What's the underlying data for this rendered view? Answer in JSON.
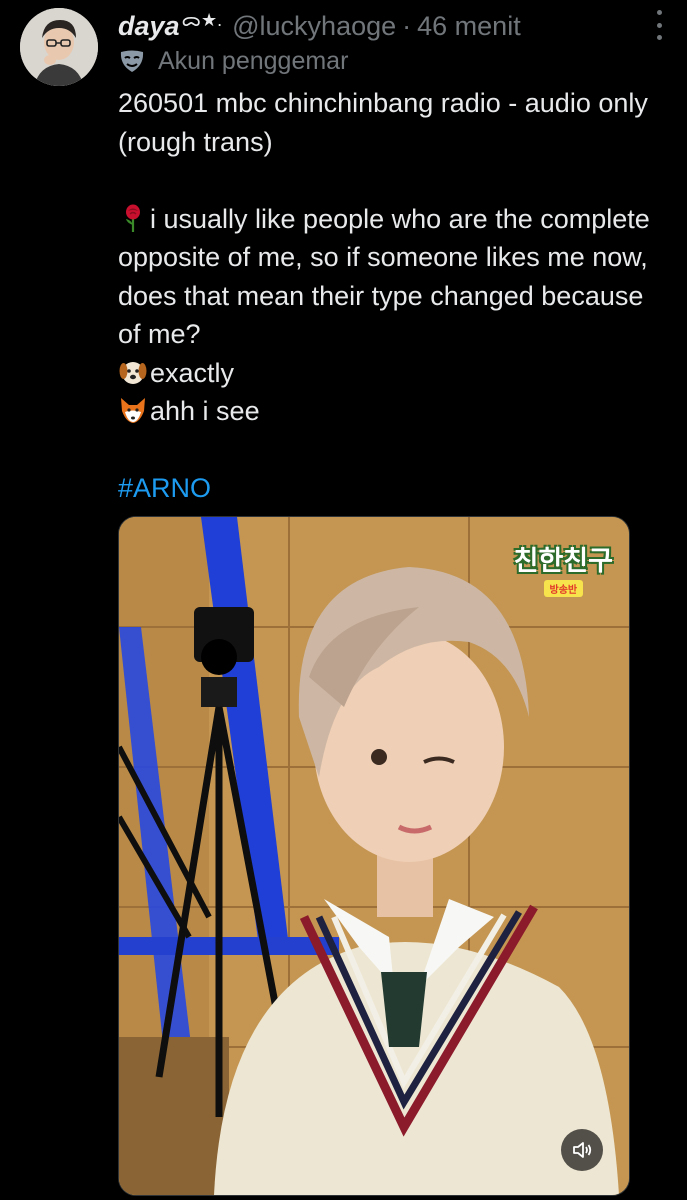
{
  "tweet": {
    "author": {
      "display_name": "daya",
      "name_decoration": "ᯅ★.",
      "handle": "@luckyhaoge",
      "separator": "·",
      "time": "46 menit"
    },
    "account_label": {
      "icon": "performing-arts-mask-icon",
      "text": "Akun penggemar"
    },
    "text": {
      "line1": "260501 mbc chinchinbang radio - audio only (rough trans)",
      "rose_line": "i usually like people who are the complete opposite of me, so if someone likes me now, does that mean their type changed because of me?",
      "dog_line": "exactly",
      "fox_line": "ahh i see",
      "hashtag": "#ARNO"
    },
    "media": {
      "watermark_title": "친한친구",
      "watermark_subtitle": "방송반",
      "volume_icon": "speaker-icon"
    },
    "colors": {
      "background": "#000000",
      "text": "#e7e9ea",
      "muted": "#71767b",
      "link": "#1d9bf0"
    }
  }
}
